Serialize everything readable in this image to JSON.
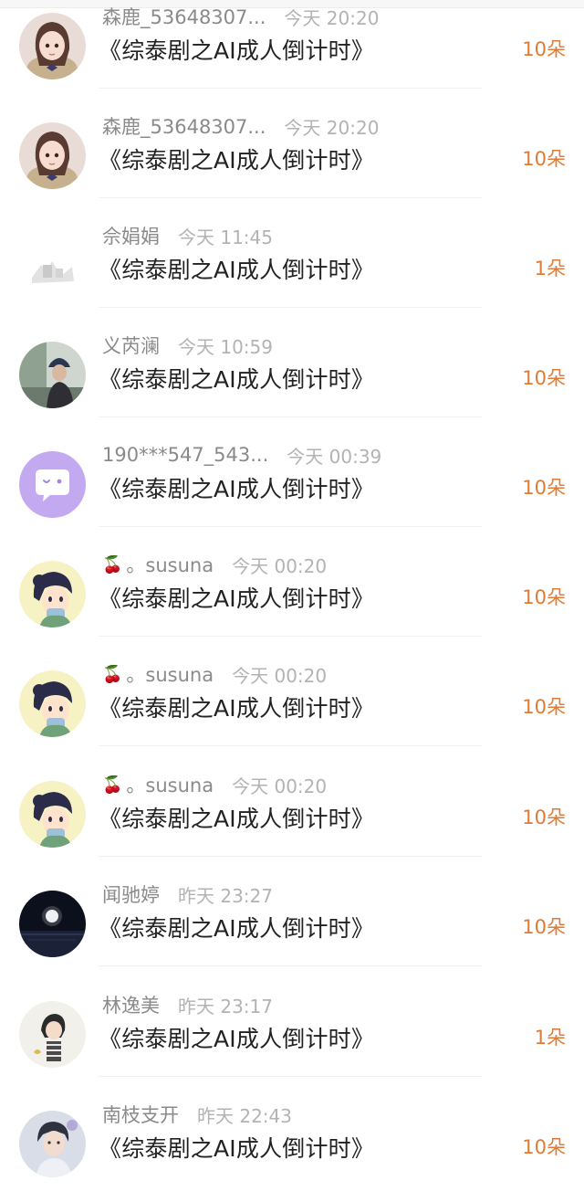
{
  "rows": [
    {
      "name": "森鹿_53648307...",
      "time": "今天 20:20",
      "title": "《综泰剧之AI成人倒计时》",
      "gift": "10朵",
      "avatar": "girl-anime-avatar"
    },
    {
      "name": "森鹿_53648307...",
      "time": "今天 20:20",
      "title": "《综泰剧之AI成人倒计时》",
      "gift": "10朵",
      "avatar": "girl-anime-avatar"
    },
    {
      "name": "佘娟娟",
      "time": "今天 11:45",
      "title": "《综泰剧之AI成人倒计时》",
      "gift": "1朵",
      "avatar": "white-sketch-avatar"
    },
    {
      "name": "义芮澜",
      "time": "今天 10:59",
      "title": "《综泰剧之AI成人倒计时》",
      "gift": "10朵",
      "avatar": "photo-girl-cap-avatar"
    },
    {
      "name": "190***547_543...",
      "time": "今天 00:39",
      "title": "《综泰剧之AI成人倒计时》",
      "gift": "10朵",
      "avatar": "default-chat-avatar"
    },
    {
      "name": "。susuna",
      "time": "今天 00:20",
      "title": "《综泰剧之AI成人倒计时》",
      "gift": "10朵",
      "avatar": "cartoon-boy-avatar",
      "cherry": "🍒"
    },
    {
      "name": "。susuna",
      "time": "今天 00:20",
      "title": "《综泰剧之AI成人倒计时》",
      "gift": "10朵",
      "avatar": "cartoon-boy-avatar",
      "cherry": "🍒"
    },
    {
      "name": "。susuna",
      "time": "今天 00:20",
      "title": "《综泰剧之AI成人倒计时》",
      "gift": "10朵",
      "avatar": "cartoon-boy-avatar",
      "cherry": "🍒"
    },
    {
      "name": "闻驰婷",
      "time": "昨天 23:27",
      "title": "《综泰剧之AI成人倒计时》",
      "gift": "10朵",
      "avatar": "night-moon-avatar"
    },
    {
      "name": "林逸美",
      "time": "昨天 23:17",
      "title": "《综泰剧之AI成人倒计时》",
      "gift": "1朵",
      "avatar": "sketch-girl-avatar"
    },
    {
      "name": "南枝支开",
      "time": "昨天 22:43",
      "title": "《综泰剧之AI成人倒计时》",
      "gift": "10朵",
      "avatar": "photo-boy-avatar"
    }
  ],
  "colors": {
    "gift": "#e07b35",
    "name": "#8a8a8a",
    "time": "#b3b3b3",
    "title": "#222222"
  }
}
